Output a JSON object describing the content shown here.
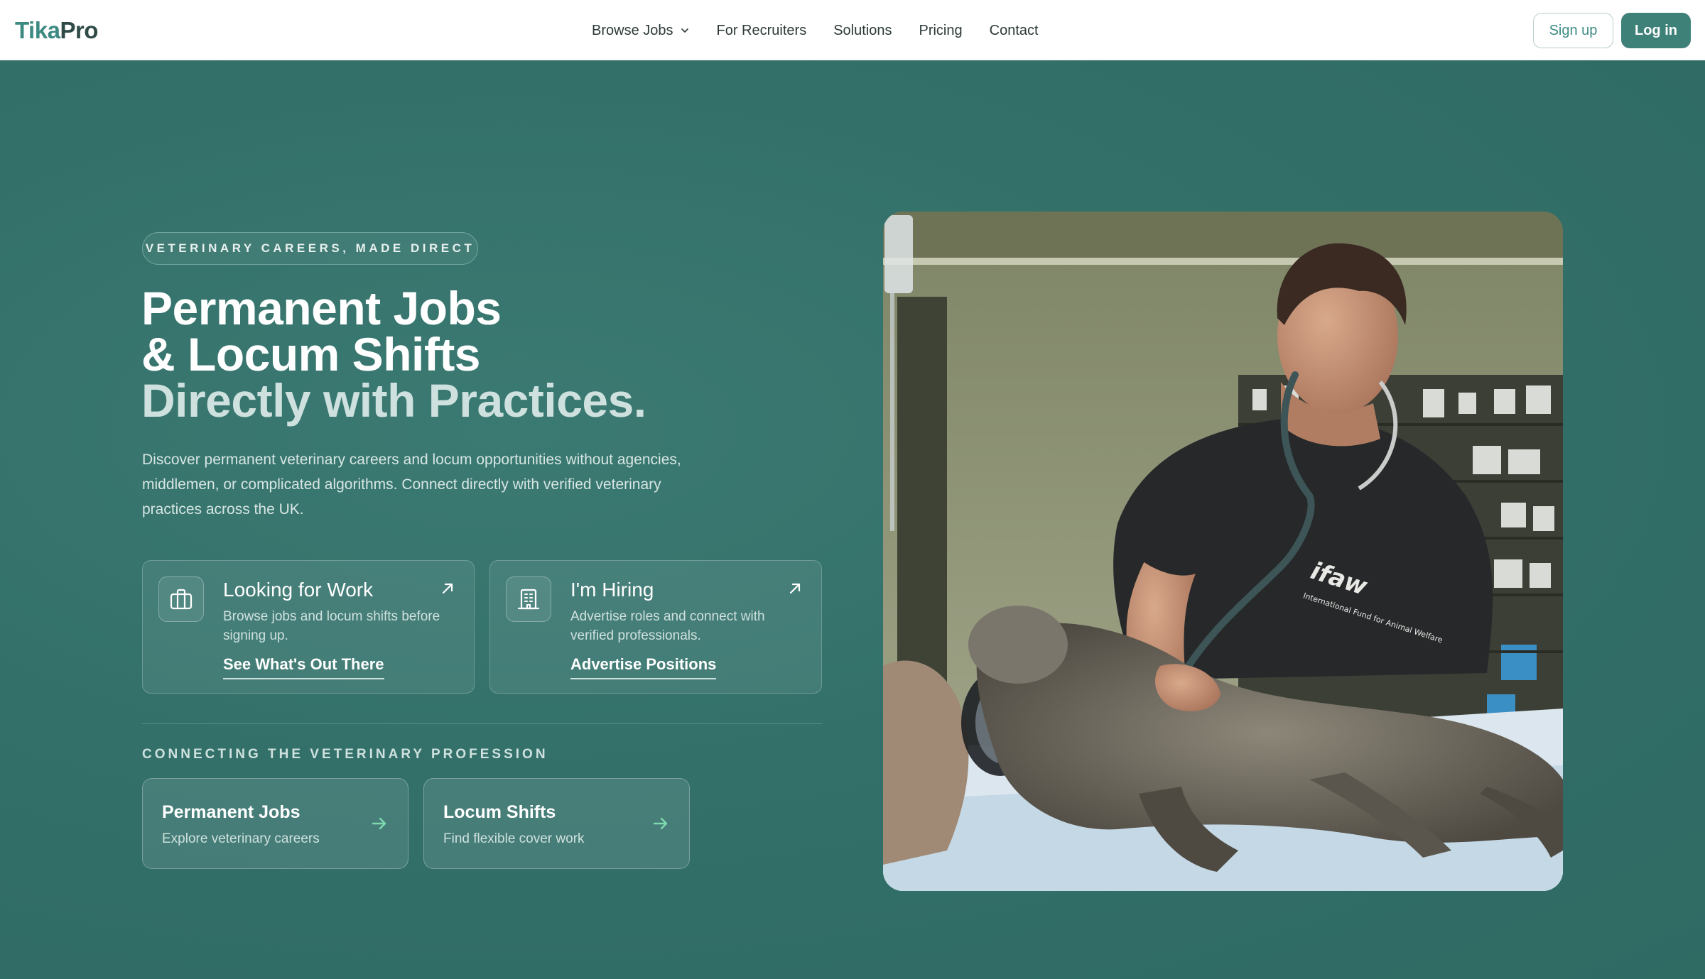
{
  "nav": {
    "logo_part1": "Tika",
    "logo_part2": "Pro",
    "links": [
      "Browse Jobs",
      "For Recruiters",
      "Solutions",
      "Pricing",
      "Contact"
    ],
    "signup": "Sign up",
    "login": "Log in"
  },
  "hero": {
    "eyebrow": "VETERINARY CAREERS, MADE DIRECT",
    "heading_line1": "Permanent Jobs",
    "heading_line2": "& Locum Shifts",
    "heading_line3": "Directly with Practices.",
    "lead": "Discover permanent veterinary careers and locum opportunities without agencies, middlemen, or complicated algorithms. Connect directly with verified veterinary practices across the UK.",
    "cards": [
      {
        "title": "Looking for Work",
        "desc": "Browse jobs and locum shifts before signing up.",
        "link": "See What's Out There",
        "icon": "briefcase-icon"
      },
      {
        "title": "I'm Hiring",
        "desc": "Advertise roles and connect with verified professionals.",
        "link": "Advertise Positions",
        "icon": "building-icon"
      }
    ],
    "section_label": "CONNECTING THE VETERINARY PROFESSION",
    "quick_links": [
      {
        "title": "Permanent Jobs",
        "sub": "Explore veterinary careers"
      },
      {
        "title": "Locum Shifts",
        "sub": "Find flexible cover work"
      }
    ],
    "photo_shirt_text": "ifaw",
    "photo_shirt_sub": "International Fund for Animal Welfare"
  },
  "colors": {
    "brand": "#3e8178",
    "hero_bg": "#33706a",
    "accent_arrow": "#7fd9b0"
  }
}
